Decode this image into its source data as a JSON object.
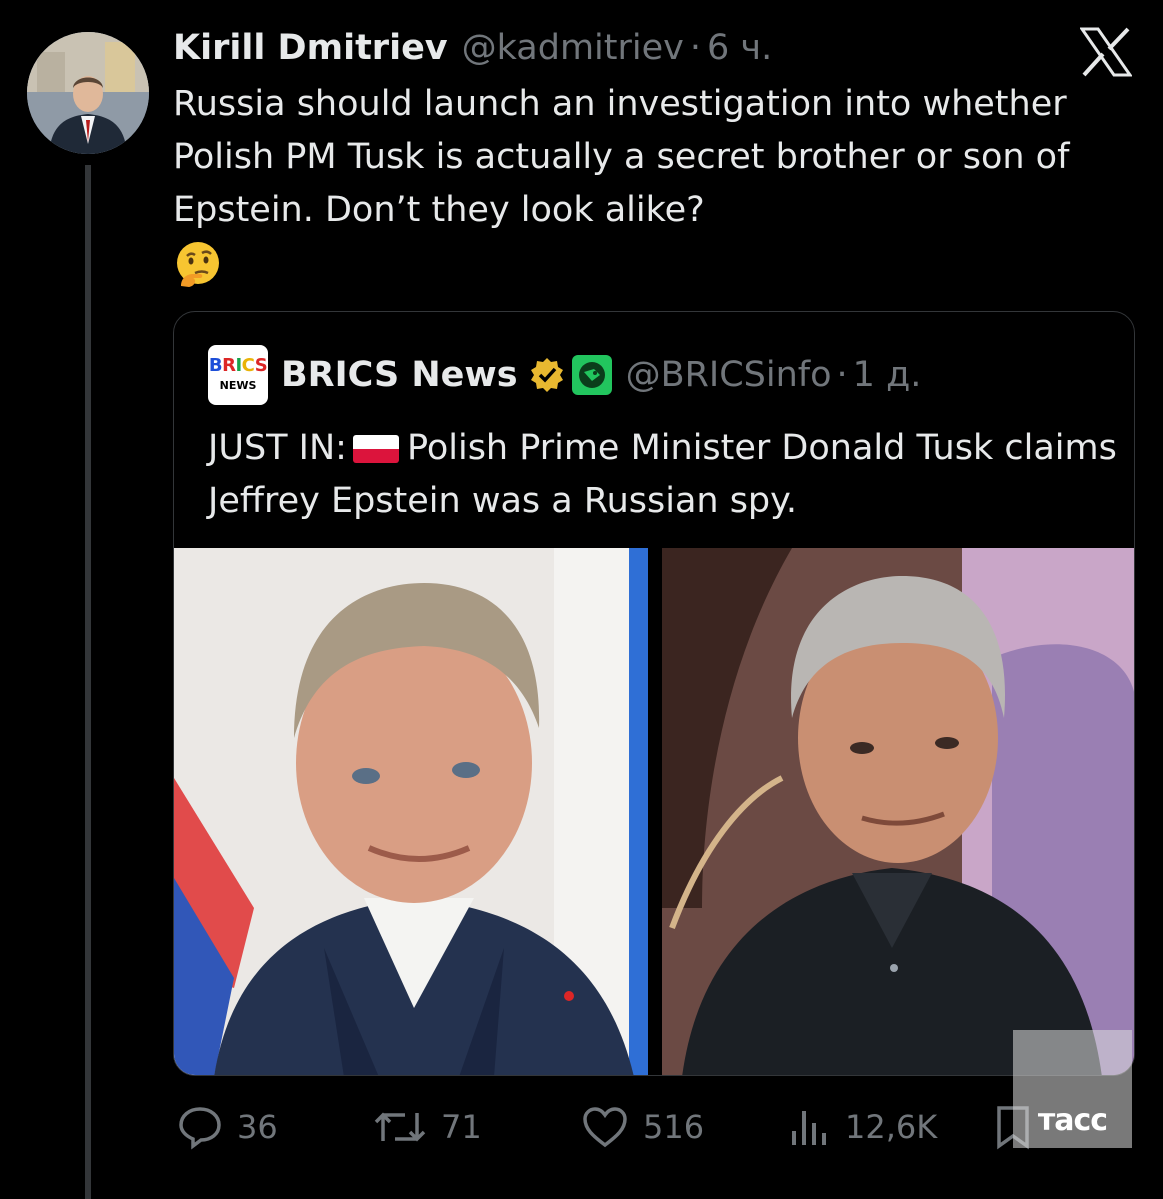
{
  "tweet": {
    "author_name": "Kirill Dmitriev",
    "author_handle": "@kadmitriev",
    "separator": "·",
    "time": "6 ч.",
    "text": "Russia should launch an investigation into whether Polish PM Tusk is actually a secret brother or son of Epstein. Don’t they look alike?",
    "emoji": "thinking-face"
  },
  "quote": {
    "author_name": "BRICS News",
    "logo_line1": "BRICS",
    "logo_line2": "NEWS",
    "author_handle": "@BRICSinfo",
    "separator": "·",
    "time": "1 д.",
    "text_prefix": "JUST IN:",
    "text_body": "Polish Prime Minister Donald Tusk claims Jeffrey Epstein was a Russian spy.",
    "flag": "poland-flag"
  },
  "actions": {
    "replies": "36",
    "reposts": "71",
    "likes": "516",
    "views": "12,6K"
  },
  "watermark": "тасс",
  "colors": {
    "background": "#000000",
    "text": "#e7e9ea",
    "muted": "#71767b",
    "border": "#333639",
    "verified_gold": "#e8b830",
    "affiliate_green": "#22c55e"
  }
}
